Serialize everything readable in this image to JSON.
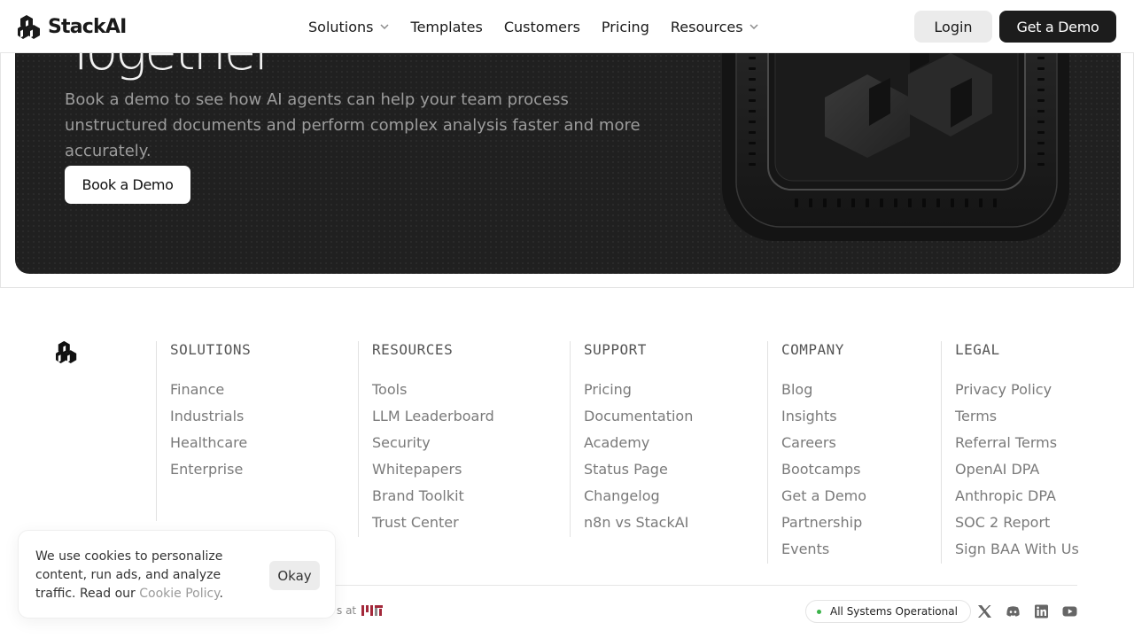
{
  "header": {
    "brand": "StackAI",
    "nav": [
      {
        "label": "Solutions",
        "has_menu": true
      },
      {
        "label": "Templates",
        "has_menu": false
      },
      {
        "label": "Customers",
        "has_menu": false
      },
      {
        "label": "Pricing",
        "has_menu": false
      },
      {
        "label": "Resources",
        "has_menu": true
      }
    ],
    "login_label": "Login",
    "demo_label": "Get a Demo"
  },
  "hero": {
    "heading_partial": "Together",
    "subtitle": "Book a demo to see how AI agents can help your team process unstructured documents and perform complex analysis faster and more accurately.",
    "cta_label": "Book a Demo"
  },
  "footer": {
    "columns": [
      {
        "heading": "SOLUTIONS",
        "links": [
          "Finance",
          "Industrials",
          "Healthcare",
          "Enterprise"
        ]
      },
      {
        "heading": "RESOURCES",
        "links": [
          "Tools",
          "LLM Leaderboard",
          "Security",
          "Whitepapers",
          "Brand Toolkit",
          "Trust Center"
        ]
      },
      {
        "heading": "SUPPORT",
        "links": [
          "Pricing",
          "Documentation",
          "Academy",
          "Status Page",
          "Changelog",
          "n8n vs StackAI"
        ]
      },
      {
        "heading": "COMPANY",
        "links": [
          "Blog",
          "Insights",
          "Careers",
          "Bootcamps",
          "Get a Demo",
          "Partnership",
          "Events"
        ]
      },
      {
        "heading": "LEGAL",
        "links": [
          "Privacy Policy",
          "Terms",
          "Referral Terms",
          "OpenAI DPA",
          "Anthropic DPA",
          "SOC 2 Report",
          "Sign BAA With Us"
        ]
      }
    ],
    "made_at_partial": "s at",
    "status_label": "All Systems Operational",
    "status_color": "#3bb34a",
    "social_icons": [
      "x-icon",
      "discord-icon",
      "linkedin-icon",
      "youtube-icon"
    ]
  },
  "cookie": {
    "text": "We use cookies to personalize content, run ads, and analyze traffic. Read our ",
    "link_label": "Cookie Policy",
    "suffix": ".",
    "button_label": "Okay"
  }
}
